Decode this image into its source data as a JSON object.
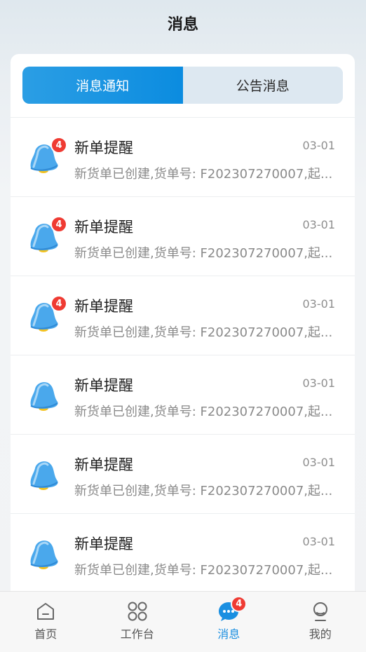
{
  "header": {
    "title": "消息"
  },
  "tabs": [
    {
      "label": "消息通知",
      "active": true
    },
    {
      "label": "公告消息",
      "active": false
    }
  ],
  "messages": [
    {
      "title": "新单提醒",
      "date": "03-01",
      "desc": "新货单已创建,货单号: F202307270007,起...",
      "badge": "4",
      "icon": "bell-icon"
    },
    {
      "title": "新单提醒",
      "date": "03-01",
      "desc": "新货单已创建,货单号: F202307270007,起...",
      "badge": "4",
      "icon": "bell-icon"
    },
    {
      "title": "新单提醒",
      "date": "03-01",
      "desc": "新货单已创建,货单号: F202307270007,起...",
      "badge": "4",
      "icon": "bell-icon"
    },
    {
      "title": "新单提醒",
      "date": "03-01",
      "desc": "新货单已创建,货单号: F202307270007,起...",
      "badge": "",
      "icon": "bell-icon"
    },
    {
      "title": "新单提醒",
      "date": "03-01",
      "desc": "新货单已创建,货单号: F202307270007,起...",
      "badge": "",
      "icon": "bell-icon"
    },
    {
      "title": "新单提醒",
      "date": "03-01",
      "desc": "新货单已创建,货单号: F202307270007,起...",
      "badge": "",
      "icon": "bell-icon"
    }
  ],
  "tabbar": [
    {
      "label": "首页",
      "icon": "home-icon",
      "active": false,
      "badge": ""
    },
    {
      "label": "工作台",
      "icon": "grid-icon",
      "active": false,
      "badge": ""
    },
    {
      "label": "消息",
      "icon": "chat-bubble-icon",
      "active": true,
      "badge": "4"
    },
    {
      "label": "我的",
      "icon": "user-icon",
      "active": false,
      "badge": ""
    }
  ],
  "colors": {
    "accent": "#1a8fe1",
    "badge": "#ef3b33",
    "bell_blue": "#4aa8ec",
    "bell_yellow": "#f4c21f"
  }
}
